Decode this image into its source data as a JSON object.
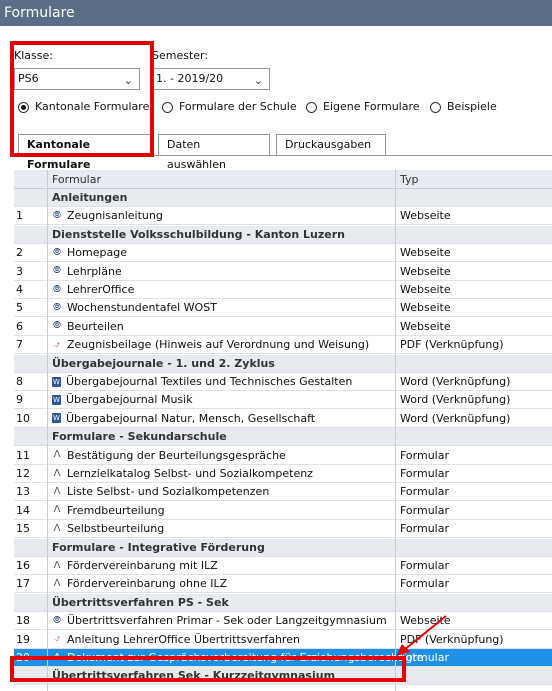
{
  "window_title": "Formulare",
  "klasse": {
    "label": "Klasse:",
    "value": "PS6"
  },
  "semester": {
    "label": "Semester:",
    "value": "1. - 2019/20"
  },
  "radios": [
    {
      "label": "Kantonale Formulare",
      "checked": true
    },
    {
      "label": "Formulare der Schule",
      "checked": false
    },
    {
      "label": "Eigene Formulare",
      "checked": false
    },
    {
      "label": "Beispiele",
      "checked": false
    }
  ],
  "tabs": [
    "Kantonale Formulare",
    "Daten auswählen",
    "Druckausgaben"
  ],
  "table": {
    "headers": {
      "col1": "Formular",
      "col2": "Typ"
    },
    "rows": [
      {
        "group": true,
        "num": "",
        "name": "Anleitungen",
        "icon": "",
        "type": ""
      },
      {
        "group": false,
        "num": "1",
        "name": "Zeugnisanleitung",
        "icon": "globe-icon",
        "type": "Webseite"
      },
      {
        "group": true,
        "num": "",
        "name": "Dienststelle Volksschulbildung - Kanton Luzern",
        "icon": "",
        "type": ""
      },
      {
        "group": false,
        "num": "2",
        "name": "Homepage",
        "icon": "globe-icon",
        "type": "Webseite"
      },
      {
        "group": false,
        "num": "3",
        "name": "Lehrpläne",
        "icon": "globe-icon",
        "type": "Webseite"
      },
      {
        "group": false,
        "num": "4",
        "name": "LehrerOffice",
        "icon": "globe-icon",
        "type": "Webseite"
      },
      {
        "group": false,
        "num": "5",
        "name": "Wochenstundentafel WOST",
        "icon": "globe-icon",
        "type": "Webseite"
      },
      {
        "group": false,
        "num": "6",
        "name": "Beurteilen",
        "icon": "globe-icon",
        "type": "Webseite"
      },
      {
        "group": false,
        "num": "7",
        "name": "Zeugnisbeilage (Hinweis auf Verordnung und Weisung)",
        "icon": "pdf-icon",
        "type": "PDF (Verknüpfung)"
      },
      {
        "group": true,
        "num": "",
        "name": "Übergabejournale - 1. und 2. Zyklus",
        "icon": "",
        "type": ""
      },
      {
        "group": false,
        "num": "8",
        "name": "Übergabejournal Textiles und Technisches Gestalten",
        "icon": "word-icon",
        "type": "Word (Verknüpfung)"
      },
      {
        "group": false,
        "num": "9",
        "name": "Übergabejournal Musik",
        "icon": "word-icon",
        "type": "Word (Verknüpfung)"
      },
      {
        "group": false,
        "num": "10",
        "name": "Übergabejournal Natur, Mensch, Gesellschaft",
        "icon": "word-icon",
        "type": "Word (Verknüpfung)"
      },
      {
        "group": true,
        "num": "",
        "name": "Formulare - Sekundarschule",
        "icon": "",
        "type": ""
      },
      {
        "group": false,
        "num": "11",
        "name": "Bestätigung der Beurteilungsgespräche",
        "icon": "form-icon",
        "type": "Formular"
      },
      {
        "group": false,
        "num": "12",
        "name": "Lernzielkatalog Selbst- und Sozialkompetenz",
        "icon": "form-icon",
        "type": "Formular"
      },
      {
        "group": false,
        "num": "13",
        "name": "Liste Selbst- und Sozialkompetenzen",
        "icon": "form-icon",
        "type": "Formular"
      },
      {
        "group": false,
        "num": "14",
        "name": "Fremdbeurteilung",
        "icon": "form-icon",
        "type": "Formular"
      },
      {
        "group": false,
        "num": "15",
        "name": "Selbstbeurteilung",
        "icon": "form-icon",
        "type": "Formular"
      },
      {
        "group": true,
        "num": "",
        "name": "Formulare - Integrative Förderung",
        "icon": "",
        "type": ""
      },
      {
        "group": false,
        "num": "16",
        "name": "Fördervereinbarung mit ILZ",
        "icon": "form-icon",
        "type": "Formular"
      },
      {
        "group": false,
        "num": "17",
        "name": "Fördervereinbarung ohne ILZ",
        "icon": "form-icon",
        "type": "Formular"
      },
      {
        "group": true,
        "num": "",
        "name": "Übertrittsverfahren PS - Sek",
        "icon": "",
        "type": ""
      },
      {
        "group": false,
        "num": "18",
        "name": "Übertrittsverfahren Primar - Sek oder Langzeitgymnasium",
        "icon": "globe-icon",
        "type": "Webseite"
      },
      {
        "group": false,
        "num": "19",
        "name": "Anleitung LehrerOffice Übertrittsverfahren",
        "icon": "pdf-icon",
        "type": "PDF (Verknüpfung)"
      },
      {
        "group": false,
        "num": "20",
        "name": "Dokument zur Gesprächsvorbereitung für Erziehungsberechtigte",
        "icon": "form-icon",
        "type": "Formular",
        "selected": true
      },
      {
        "group": true,
        "num": "",
        "name": "Übertrittsverfahren Sek - Kurzzeitgymnasium",
        "icon": "",
        "type": ""
      }
    ]
  },
  "colors": {
    "title_bar": "#5b6e85",
    "highlight_box": "#e30000",
    "selection": "#1e90e6"
  }
}
